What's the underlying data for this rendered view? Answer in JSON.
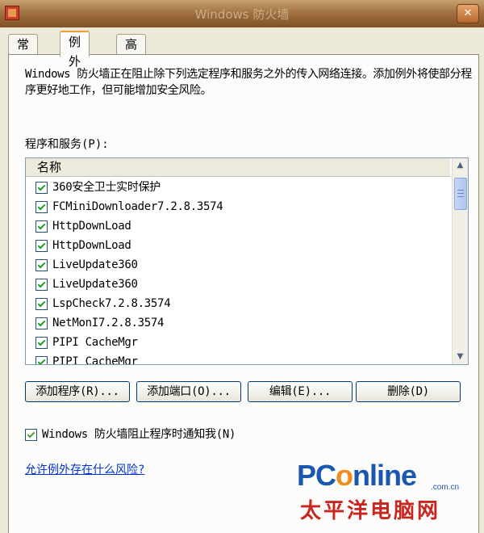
{
  "window": {
    "title": "Windows 防火墙"
  },
  "tabs": [
    {
      "label": "常规"
    },
    {
      "label": "例外"
    },
    {
      "label": "高级"
    }
  ],
  "description": "Windows 防火墙正在阻止除下列选定程序和服务之外的传入网络连接。添加例外将使部分程序更好地工作，但可能增加安全风险。",
  "programs_label": "程序和服务(P):",
  "list": {
    "header": "名称",
    "items": [
      {
        "label": "360安全卫士实时保护",
        "checked": true
      },
      {
        "label": "FCMiniDownloader7.2.8.3574",
        "checked": true
      },
      {
        "label": "HttpDownLoad",
        "checked": true
      },
      {
        "label": "HttpDownLoad",
        "checked": true
      },
      {
        "label": "LiveUpdate360",
        "checked": true
      },
      {
        "label": "LiveUpdate360",
        "checked": true
      },
      {
        "label": "LspCheck7.2.8.3574",
        "checked": true
      },
      {
        "label": "NetMonI7.2.8.3574",
        "checked": true
      },
      {
        "label": "PIPI CacheMgr",
        "checked": true
      },
      {
        "label": "PIPI CacheMgr",
        "checked": true
      }
    ]
  },
  "buttons": {
    "add_program": "添加程序(R)...",
    "add_port": "添加端口(O)...",
    "edit": "编辑(E)...",
    "delete": "删除(D)"
  },
  "notify": {
    "label": "Windows 防火墙阻止程序时通知我(N)",
    "checked": true
  },
  "risk_link": "允许例外存在什么风险?",
  "watermark": {
    "logo_pre": "PC",
    "logo_o": "o",
    "logo_post": "nline",
    "domain": ".com.cn",
    "name": "太平洋电脑网"
  },
  "colors": {
    "accent": "#e8a030",
    "link": "#0033cc",
    "watermark_blue": "#1a58b0",
    "watermark_red": "#c8261e"
  }
}
